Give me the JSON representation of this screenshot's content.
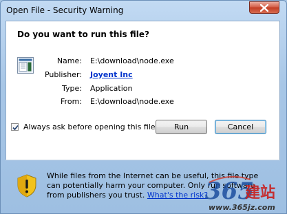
{
  "window": {
    "title": "Open File - Security Warning"
  },
  "dialog": {
    "heading": "Do you want to run this file?",
    "fields": [
      {
        "label": "Name:",
        "value": "E:\\download\\node.exe"
      },
      {
        "label": "Publisher:",
        "value": "Joyent Inc"
      },
      {
        "label": "Type:",
        "value": "Application"
      },
      {
        "label": "From:",
        "value": "E:\\download\\node.exe"
      }
    ],
    "run_label": "Run",
    "cancel_label": "Cancel",
    "checkbox": {
      "label": "Always ask before opening this file",
      "checked": true
    }
  },
  "warning": {
    "text": "While files from the Internet can be useful, this file type can potentially harm your computer. Only run software from publishers you trust.",
    "link": "What's the risk?",
    "icon": "shield-warning-icon"
  },
  "watermark": {
    "logo": "365建站",
    "url": "www.365jz.com"
  },
  "colors": {
    "link": "#0033cc",
    "close_button": "#c23c23",
    "shield_yellow": "#f2c21b"
  }
}
